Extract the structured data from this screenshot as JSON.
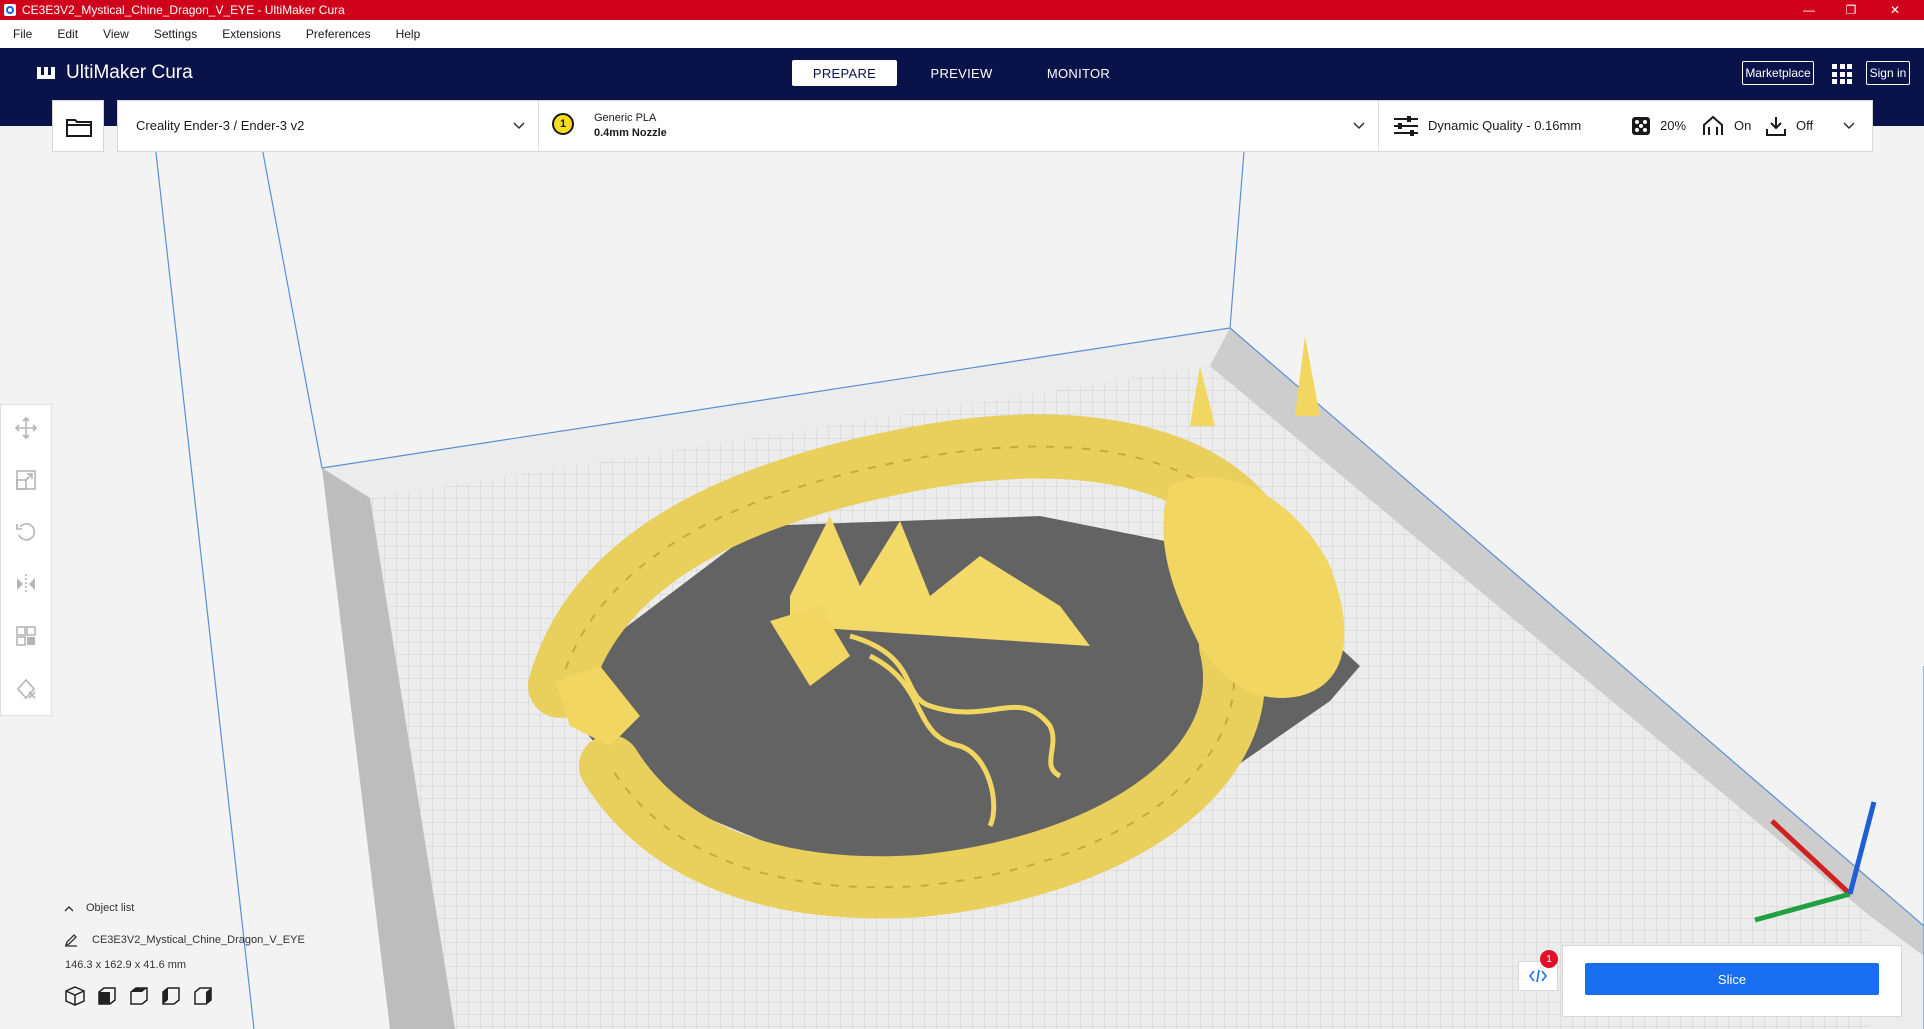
{
  "window": {
    "title": "CE3E3V2_Mystical_Chine_Dragon_V_EYE - UltiMaker Cura",
    "controls": [
      "—",
      "❐",
      "✕"
    ]
  },
  "menu": [
    "File",
    "Edit",
    "View",
    "Settings",
    "Extensions",
    "Preferences",
    "Help"
  ],
  "header": {
    "brand": "UltiMaker Cura",
    "tabs": [
      "PREPARE",
      "PREVIEW",
      "MONITOR"
    ],
    "active_tab": "PREPARE",
    "marketplace_label": "Marketplace",
    "signin_label": "Sign in"
  },
  "toolbar": {
    "printer": "Creality Ender-3 / Ender-3 v2",
    "extruder_number": "1",
    "material": "Generic PLA",
    "nozzle": "0.4mm Nozzle",
    "profile": "Dynamic Quality - 0.16mm",
    "infill": "20%",
    "support": "On",
    "adhesion": "Off"
  },
  "tools": [
    "move-icon",
    "scale-icon",
    "rotate-icon",
    "mirror-icon",
    "per-model-settings-icon",
    "support-blocker-icon"
  ],
  "object_list": {
    "header": "Object list",
    "object_name": "CE3E3V2_Mystical_Chine_Dragon_V_EYE",
    "dimensions": "146.3 x 162.9 x 41.6 mm"
  },
  "slice": {
    "label": "Slice",
    "notification_count": "1"
  },
  "colors": {
    "titlebar": "#d0021b",
    "header": "#09134a",
    "accent": "#196ef0",
    "model": "#f5dc6e"
  }
}
